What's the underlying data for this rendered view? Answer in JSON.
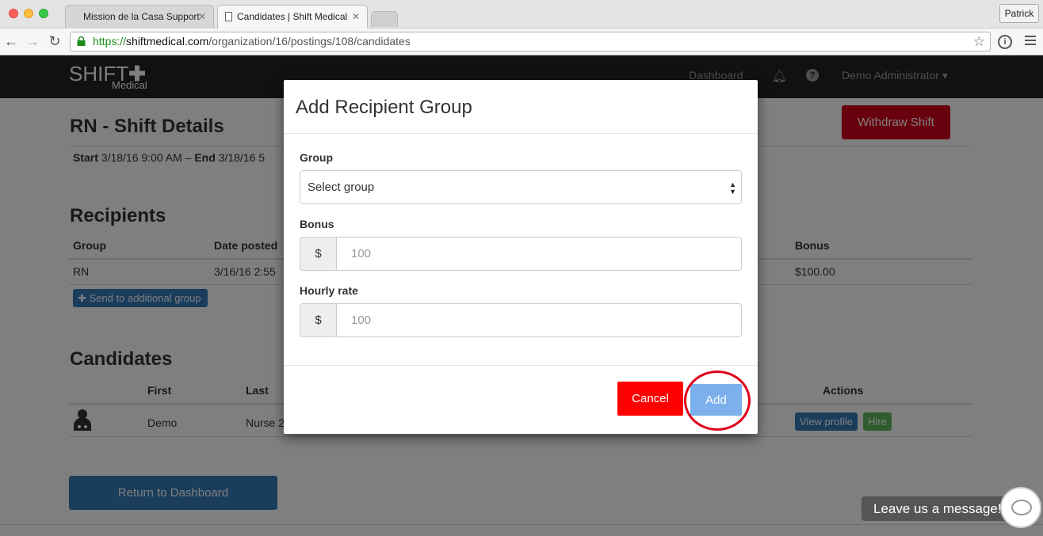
{
  "browser": {
    "tabs": [
      {
        "title": "Mission de la Casa Support",
        "active": false
      },
      {
        "title": "Candidates | Shift Medical",
        "active": true
      }
    ],
    "profile": "Patrick",
    "url_scheme": "https://",
    "url_host": "shiftmedical.com",
    "url_path": "/organization/16/postings/108/candidates"
  },
  "header": {
    "logo_main": "SHIFT",
    "logo_plus": "✚",
    "logo_sub": "Medical",
    "nav_dashboard": "Dashboard",
    "user_menu": "Demo Administrator ▾"
  },
  "page": {
    "title": "RN - Shift Details",
    "start_label": "Start",
    "start_value": "3/18/16 9:00 AM",
    "end_label": "End",
    "end_value": "3/18/16 5",
    "withdraw_label": "Withdraw Shift",
    "recipients": {
      "heading": "Recipients",
      "columns": [
        "Group",
        "Date posted",
        "Bonus"
      ],
      "rows": [
        {
          "group": "RN",
          "date": "3/16/16 2:55",
          "bonus": "$100.00"
        }
      ],
      "send_button": "Send to additional group"
    },
    "candidates": {
      "heading": "Candidates",
      "columns": [
        "First",
        "Last",
        "Actions"
      ],
      "rows": [
        {
          "first": "Demo",
          "last": "Nurse 2"
        }
      ],
      "view_profile": "View profile",
      "hire": "Hire"
    },
    "return_button": "Return to Dashboard"
  },
  "modal": {
    "title": "Add Recipient Group",
    "group_label": "Group",
    "group_select": "Select group",
    "bonus_label": "Bonus",
    "bonus_addon": "$",
    "bonus_placeholder": "100",
    "hourly_label": "Hourly rate",
    "hourly_addon": "$",
    "hourly_placeholder": "100",
    "cancel": "Cancel",
    "add": "Add"
  },
  "chat": {
    "label": "Leave us a message!"
  },
  "colors": {
    "danger": "#d0021b",
    "primary": "#337ab7",
    "success": "#5cb85c",
    "add_button": "#7bb0ec",
    "cancel_button": "#ff0000",
    "highlight": "#e0001a"
  }
}
